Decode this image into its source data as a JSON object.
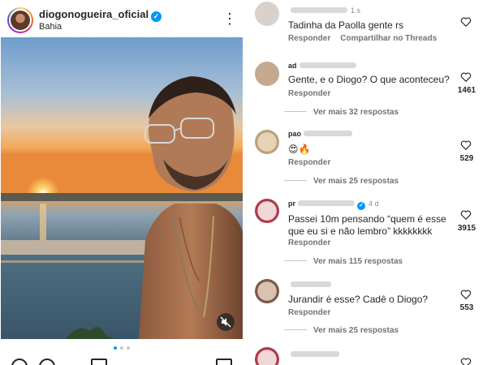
{
  "post": {
    "username": "diogonogueira_oficial",
    "verified_mark": "✓",
    "location": "Bahia",
    "more_icon": "⋮",
    "carousel": {
      "count": 3,
      "active": 1
    },
    "photo_description_icons": [
      "sunset-photo",
      "mute-icon"
    ]
  },
  "comments": [
    {
      "name": "",
      "time": "1 s",
      "text": "Tadinha da Paolla gente rs",
      "actions": [
        "Responder",
        "Compartilhar no Threads"
      ],
      "likes": "",
      "replies": ""
    },
    {
      "name": "ad",
      "time": "",
      "text": "Gente, e o Diogo? O que aconteceu?",
      "actions": [
        "Responder"
      ],
      "likes": "1461",
      "replies": "Ver mais 32 respostas"
    },
    {
      "name": "pao",
      "time": "",
      "text": "😍🔥",
      "actions": [
        "Responder"
      ],
      "likes": "529",
      "replies": "Ver mais 25 respostas"
    },
    {
      "name": "pr",
      "time": "4 d",
      "text_line1": "Passei 10m pensando “quem é esse",
      "text_line2": "que eu si       e não lembro” kkkkkkkk",
      "actions": [
        "Responder"
      ],
      "likes": "3915",
      "replies": "Ver mais 115 respostas"
    },
    {
      "name": "",
      "time": "",
      "text": "Jurandir é esse? Cadê o Diogo?",
      "actions": [
        "Responder"
      ],
      "likes": "553",
      "replies": "Ver mais 25 respostas"
    }
  ],
  "colors": {
    "verified": "#0095f6",
    "secondary_text": "#737373",
    "primary_text": "#262626"
  }
}
